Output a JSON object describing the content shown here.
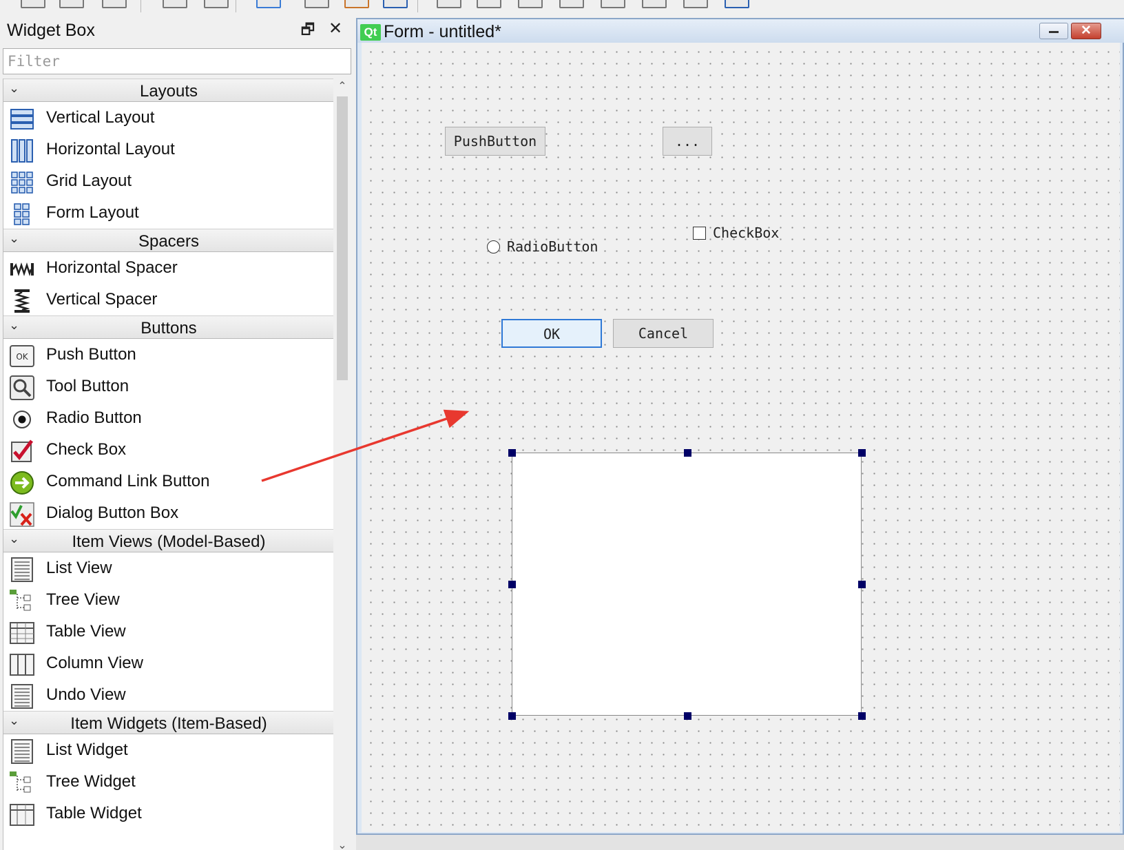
{
  "widget_box": {
    "title": "Widget Box",
    "filter_placeholder": "Filter",
    "categories": [
      {
        "label": "Layouts",
        "items": [
          {
            "label": "Vertical Layout",
            "icon": "vertical-layout-icon"
          },
          {
            "label": "Horizontal Layout",
            "icon": "horizontal-layout-icon"
          },
          {
            "label": "Grid Layout",
            "icon": "grid-layout-icon"
          },
          {
            "label": "Form Layout",
            "icon": "form-layout-icon"
          }
        ]
      },
      {
        "label": "Spacers",
        "items": [
          {
            "label": "Horizontal Spacer",
            "icon": "horizontal-spacer-icon"
          },
          {
            "label": "Vertical Spacer",
            "icon": "vertical-spacer-icon"
          }
        ]
      },
      {
        "label": "Buttons",
        "items": [
          {
            "label": "Push Button",
            "icon": "push-button-icon"
          },
          {
            "label": "Tool Button",
            "icon": "tool-button-icon"
          },
          {
            "label": "Radio Button",
            "icon": "radio-button-icon"
          },
          {
            "label": "Check Box",
            "icon": "check-box-icon"
          },
          {
            "label": "Command Link Button",
            "icon": "command-link-icon"
          },
          {
            "label": "Dialog Button Box",
            "icon": "dialog-button-box-icon"
          }
        ]
      },
      {
        "label": "Item Views (Model-Based)",
        "items": [
          {
            "label": "List View",
            "icon": "list-view-icon"
          },
          {
            "label": "Tree View",
            "icon": "tree-view-icon"
          },
          {
            "label": "Table View",
            "icon": "table-view-icon"
          },
          {
            "label": "Column View",
            "icon": "column-view-icon"
          },
          {
            "label": "Undo View",
            "icon": "undo-view-icon"
          }
        ]
      },
      {
        "label": "Item Widgets (Item-Based)",
        "items": [
          {
            "label": "List Widget",
            "icon": "list-widget-icon"
          },
          {
            "label": "Tree Widget",
            "icon": "tree-widget-icon"
          },
          {
            "label": "Table Widget",
            "icon": "table-widget-icon"
          }
        ]
      }
    ]
  },
  "form_window": {
    "badge": "Qt",
    "title": "Form - untitled*",
    "widgets": {
      "push_button": "PushButton",
      "tool_button": "...",
      "radio_button": "RadioButton",
      "check_box": "CheckBox",
      "ok_button": "OK",
      "cancel_button": "Cancel"
    }
  },
  "colors": {
    "accent": "#2e78d6",
    "arrow": "#e8382f",
    "handle": "#000066"
  }
}
